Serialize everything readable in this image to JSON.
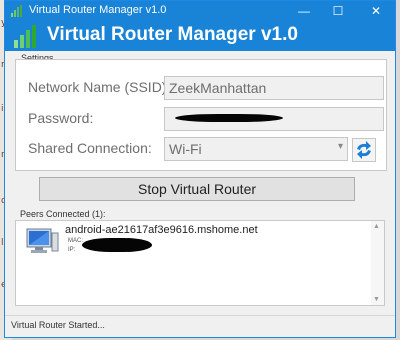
{
  "window": {
    "title": "Virtual Router Manager v1.0",
    "controls": {
      "minimize": "—",
      "maximize": "☐",
      "close": "✕"
    }
  },
  "banner": {
    "title": "Virtual Router Manager v1.0"
  },
  "settings": {
    "legend": "Settings",
    "network_name_label": "Network Name (SSID):",
    "network_name_value": "ZeekManhattan",
    "password_label": "Password:",
    "shared_connection_label": "Shared Connection:",
    "shared_connection_value": "Wi-Fi"
  },
  "actions": {
    "stop_label": "Stop Virtual Router"
  },
  "peers": {
    "label": "Peers Connected (1):",
    "items": [
      {
        "hostname": "android-ae21617af3e9616.mshome.net",
        "mac_label": "MAC:",
        "ip_label": "IP:"
      }
    ]
  },
  "status": {
    "text": "Virtual Router Started..."
  },
  "colors": {
    "titlebar": "#1883d7",
    "window_bg": "#f0f0f0"
  },
  "icons": {
    "app": "signal-bars-icon",
    "refresh": "refresh-arrows-icon",
    "peer": "computer-monitor-icon"
  }
}
